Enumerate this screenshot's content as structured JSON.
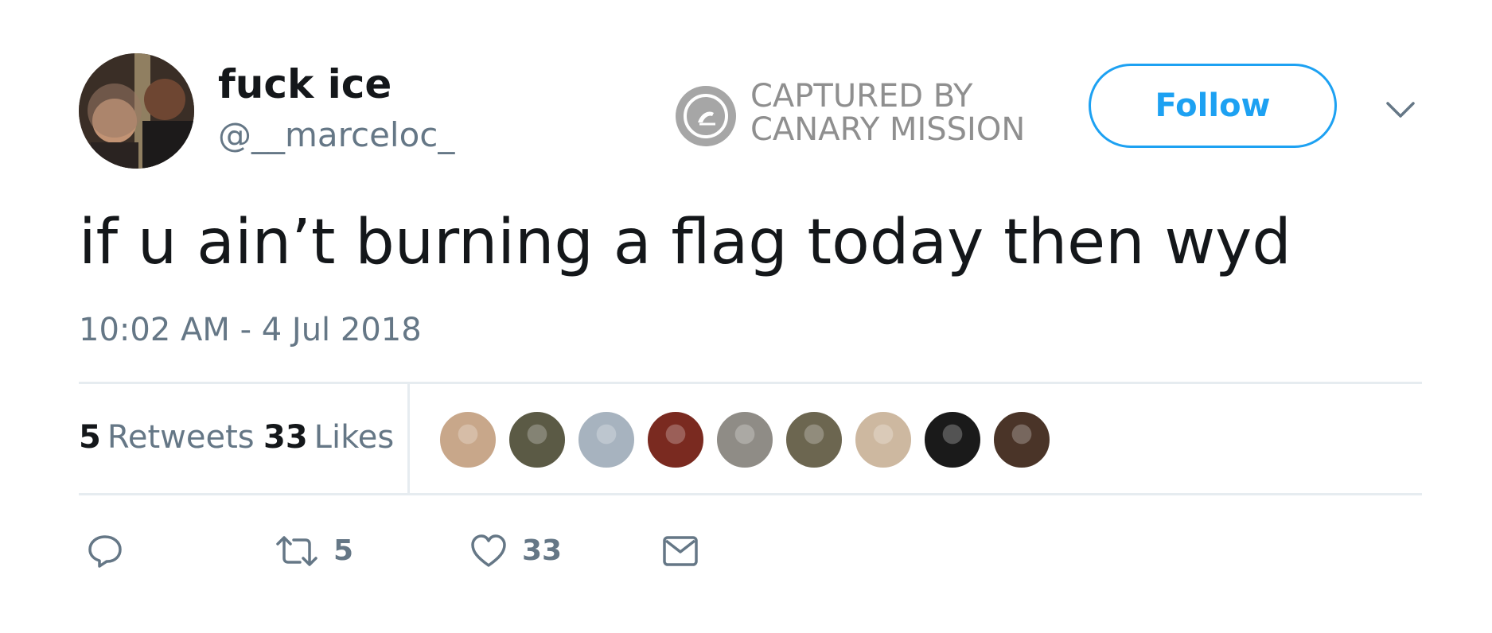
{
  "user": {
    "display_name": "fuck ice",
    "username": "@__marceloc_"
  },
  "watermark": {
    "line1": "CAPTURED BY",
    "line2": "CANARY MISSION"
  },
  "follow_label": "Follow",
  "tweet": {
    "text": "if u ain’t burning a flag today then wyd",
    "timestamp": "10:02 AM - 4 Jul 2018"
  },
  "stats": {
    "retweets_count": "5",
    "retweets_label": "Retweets",
    "likes_count": "33",
    "likes_label": "Likes"
  },
  "likers": [
    {
      "color": "#c8a78a"
    },
    {
      "color": "#5b5a45"
    },
    {
      "color": "#a7b3bf"
    },
    {
      "color": "#7a2a20"
    },
    {
      "color": "#8f8c86"
    },
    {
      "color": "#6c6650"
    },
    {
      "color": "#cdb8a0"
    },
    {
      "color": "#1a1a1a"
    },
    {
      "color": "#4a3428"
    }
  ],
  "actions": {
    "retweet_count": "5",
    "like_count": "33"
  },
  "colors": {
    "accent": "#1da1f2",
    "secondary_text": "#657786",
    "primary_text": "#14171a",
    "divider": "#e6ecf0"
  }
}
